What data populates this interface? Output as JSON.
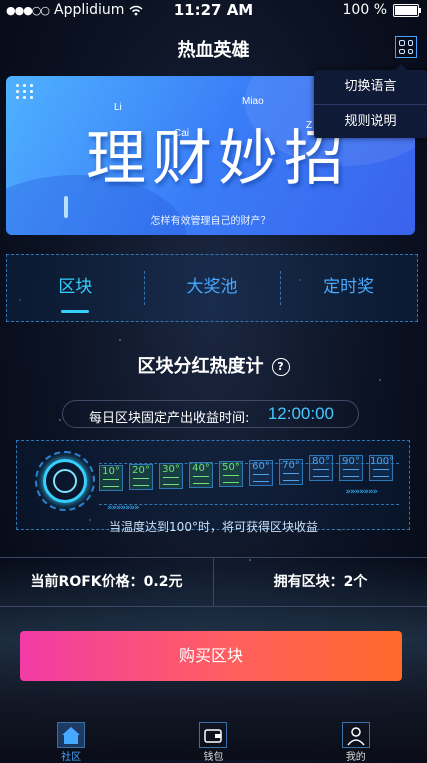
{
  "status_bar": {
    "carrier": "Applidium",
    "time": "11:27 AM",
    "battery": "100 %"
  },
  "nav": {
    "title": "热血英雄",
    "menu_icon": "grid-icon"
  },
  "menu": {
    "items": [
      "切换语言",
      "规则说明"
    ]
  },
  "banner": {
    "headline": "理财妙招",
    "pinyin": [
      "Li",
      "Cai",
      "Miao",
      "Z"
    ],
    "subtitle": "怎样有效管理自己的财产？"
  },
  "tabs": [
    {
      "label": "区块",
      "active": true
    },
    {
      "label": "大奖池",
      "active": false
    },
    {
      "label": "定时奖",
      "active": false
    }
  ],
  "section": {
    "title": "区块分红热度计",
    "help_icon": "question-circle-icon"
  },
  "daily_time": {
    "label": "每日区块固定产出收益时间:",
    "value": "12:00:00"
  },
  "gauge": {
    "levels": [
      "10°",
      "20°",
      "30°",
      "40°",
      "50°",
      "60°",
      "70°",
      "80°",
      "90°",
      "100°"
    ],
    "active_levels": 5,
    "note": "当温度达到100°时，将可获得区块收益"
  },
  "info": {
    "price": "当前ROFK价格：0.2元",
    "owned": "拥有区块：2个"
  },
  "buy_button": "购买区块",
  "tabbar": [
    {
      "label": "社区",
      "icon": "home-icon",
      "active": true
    },
    {
      "label": "钱包",
      "icon": "wallet-icon",
      "active": false
    },
    {
      "label": "我的",
      "icon": "profile-icon",
      "active": false
    }
  ],
  "colors": {
    "accent": "#36d0ff",
    "button_start": "#f23ba6",
    "button_end": "#ff6a2b",
    "gauge_on": "#6fe07a",
    "gauge_off": "#4ea3e6"
  }
}
